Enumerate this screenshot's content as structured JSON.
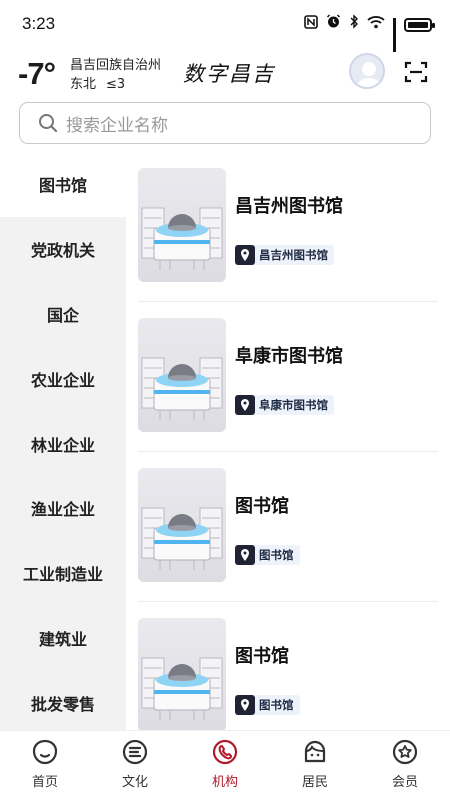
{
  "status_bar": {
    "time": "3:23",
    "icons": [
      "nfc-icon",
      "alarm-icon",
      "bluetooth-icon",
      "wifi-icon",
      "signal-icon",
      "battery-icon"
    ]
  },
  "header": {
    "temperature": "-7°",
    "location": "昌吉回族自治州",
    "wind_direction": "东北",
    "wind_level": "≤3",
    "brand": "数字昌吉"
  },
  "search": {
    "placeholder": "搜索企业名称"
  },
  "sidenav": {
    "items": [
      {
        "label": "图书馆",
        "active": true
      },
      {
        "label": "党政机关"
      },
      {
        "label": "国企"
      },
      {
        "label": "农业企业"
      },
      {
        "label": "林业企业"
      },
      {
        "label": "渔业企业"
      },
      {
        "label": "工业制造业"
      },
      {
        "label": "建筑业"
      },
      {
        "label": "批发零售"
      }
    ]
  },
  "list": {
    "items": [
      {
        "title": "昌吉州图书馆",
        "tag": "昌吉州图书馆"
      },
      {
        "title": "阜康市图书馆",
        "tag": "阜康市图书馆"
      },
      {
        "title": "图书馆",
        "tag": "图书馆"
      },
      {
        "title": "图书馆",
        "tag": "图书馆"
      }
    ]
  },
  "tabbar": {
    "tabs": [
      {
        "label": "首页",
        "icon": "home-icon"
      },
      {
        "label": "文化",
        "icon": "culture-icon"
      },
      {
        "label": "机构",
        "icon": "institution-icon",
        "active": true
      },
      {
        "label": "居民",
        "icon": "resident-icon"
      },
      {
        "label": "会员",
        "icon": "member-icon"
      }
    ]
  },
  "colors": {
    "accent": "#b01a2b",
    "sidenav_bg": "#f2f2f2",
    "tag_bg": "#eef2fa"
  }
}
